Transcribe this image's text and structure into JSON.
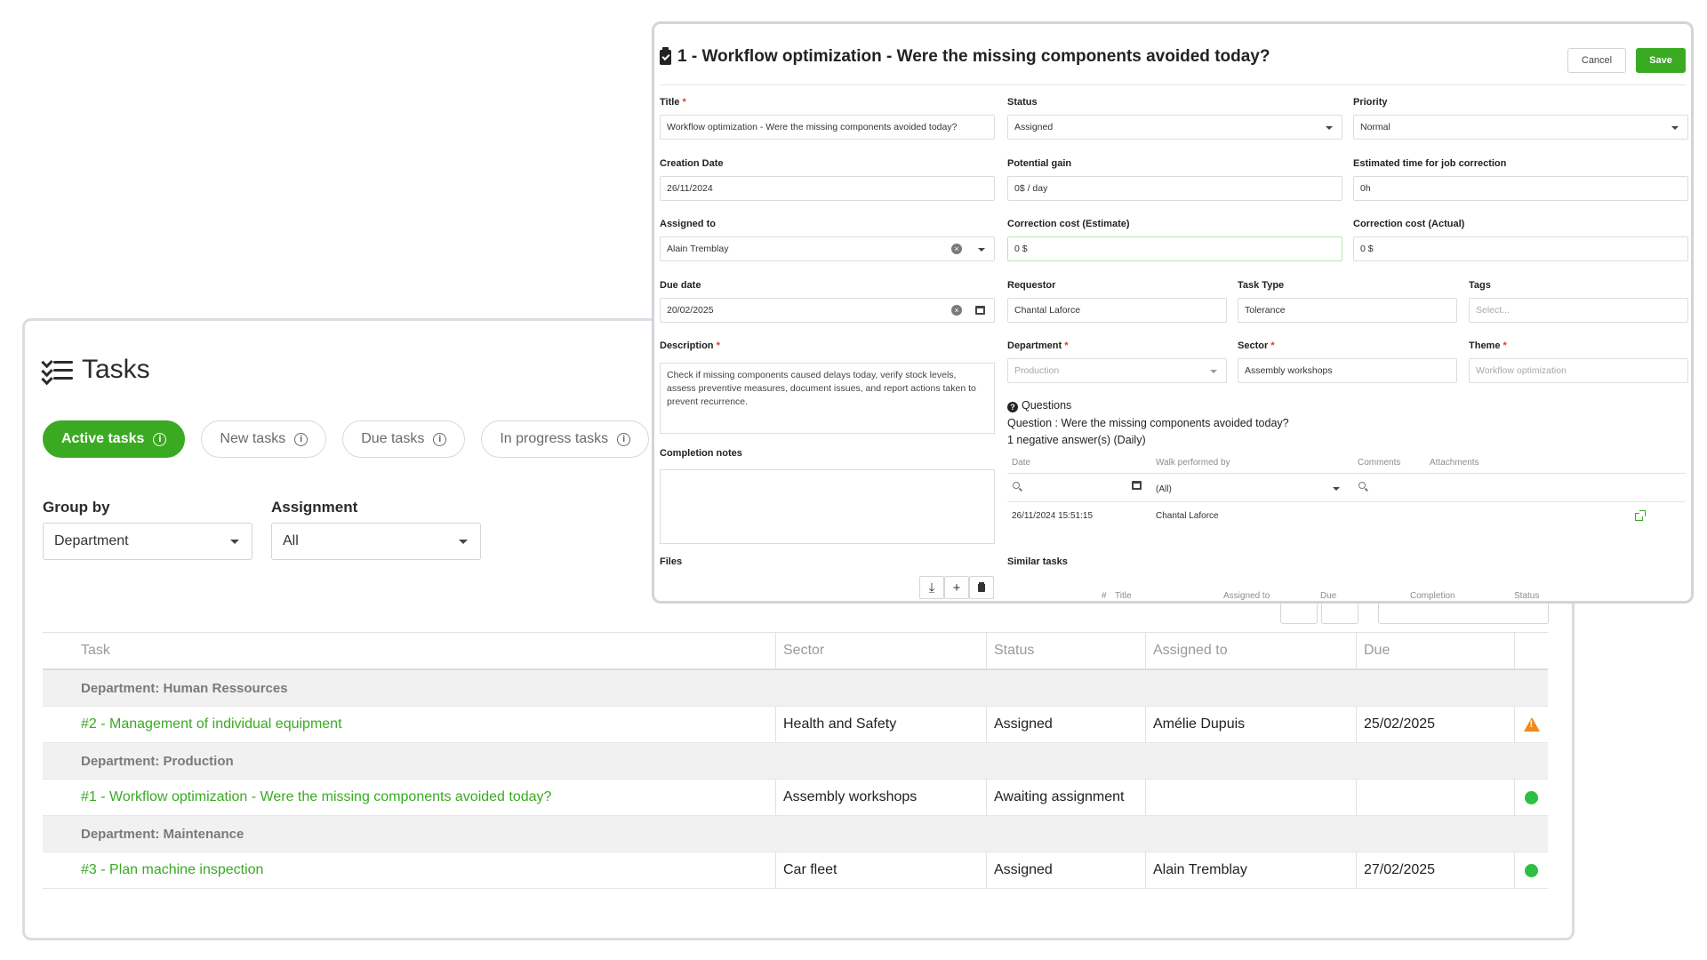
{
  "tasks_page": {
    "title": "Tasks",
    "pills": [
      {
        "label": "Active tasks"
      },
      {
        "label": "New tasks"
      },
      {
        "label": "Due tasks"
      },
      {
        "label": "In progress tasks"
      }
    ],
    "group_by": {
      "label": "Group by",
      "value": "Department"
    },
    "assignment": {
      "label": "Assignment",
      "value": "All"
    },
    "table": {
      "headers": [
        "Task",
        "Sector",
        "Status",
        "Assigned to",
        "Due"
      ],
      "groups": [
        {
          "label": "Department: Human Ressources",
          "rows": [
            {
              "task": "#2 - Management of individual equipment",
              "sector": "Health and Safety",
              "status": "Assigned",
              "assigned_to": "Amélie Dupuis",
              "due": "25/02/2025",
              "indicator": "warning"
            }
          ]
        },
        {
          "label": "Department: Production",
          "rows": [
            {
              "task": "#1 - Workflow optimization - Were the missing components avoided today?",
              "sector": "Assembly workshops",
              "status": "Awaiting assignment",
              "assigned_to": "",
              "due": "",
              "indicator": "ok"
            }
          ]
        },
        {
          "label": "Department: Maintenance",
          "rows": [
            {
              "task": "#3 - Plan machine inspection",
              "sector": "Car fleet",
              "status": "Assigned",
              "assigned_to": "Alain Tremblay",
              "due": "27/02/2025",
              "indicator": "ok"
            }
          ]
        }
      ]
    }
  },
  "modal": {
    "title": "1 - Workflow optimization - Were the missing components avoided today?",
    "cancel_label": "Cancel",
    "save_label": "Save",
    "fields": {
      "title": {
        "label": "Title",
        "value": "Workflow optimization - Were the missing components avoided today?"
      },
      "status": {
        "label": "Status",
        "value": "Assigned"
      },
      "priority": {
        "label": "Priority",
        "value": "Normal"
      },
      "creation_date": {
        "label": "Creation Date",
        "value": "26/11/2024"
      },
      "potential_gain": {
        "label": "Potential gain",
        "value": "0$ / day"
      },
      "estimated_time": {
        "label": "Estimated time for job correction",
        "value": "0h"
      },
      "assigned_to": {
        "label": "Assigned to",
        "value": "Alain Tremblay"
      },
      "cost_estimate": {
        "label": "Correction cost (Estimate)",
        "value": "0 $"
      },
      "cost_actual": {
        "label": "Correction cost (Actual)",
        "value": "0 $"
      },
      "due_date": {
        "label": "Due date",
        "value": "20/02/2025"
      },
      "requestor": {
        "label": "Requestor",
        "value": "Chantal Laforce"
      },
      "task_type": {
        "label": "Task Type",
        "value": "Tolerance"
      },
      "tags": {
        "label": "Tags",
        "placeholder": "Select..."
      },
      "description": {
        "label": "Description",
        "value": "Check if missing components caused delays today, verify stock levels, assess preventive measures, document issues, and report actions taken to prevent recurrence."
      },
      "department": {
        "label": "Department",
        "value": "Production"
      },
      "sector": {
        "label": "Sector",
        "value": "Assembly workshops"
      },
      "theme": {
        "label": "Theme",
        "value": "Workflow optimization"
      },
      "completion_notes": {
        "label": "Completion notes",
        "value": ""
      },
      "files": {
        "label": "Files"
      }
    },
    "questions": {
      "heading": "Questions",
      "question": "Question : Were the missing components avoided today?",
      "summary": "1 negative answer(s) (Daily)",
      "columns": [
        "Date",
        "Walk performed by",
        "Comments",
        "Attachments"
      ],
      "filter_walk": "(All)",
      "rows": [
        {
          "date": "26/11/2024 15:51:15",
          "walk_by": "Chantal Laforce"
        }
      ]
    },
    "similar_tasks": {
      "label": "Similar tasks",
      "columns": [
        "#",
        "Title",
        "Assigned to",
        "Due",
        "Completion",
        "Status"
      ]
    }
  },
  "colors": {
    "accent": "#3aaa22",
    "warning": "#f08a1c",
    "ok": "#2dbf43"
  }
}
